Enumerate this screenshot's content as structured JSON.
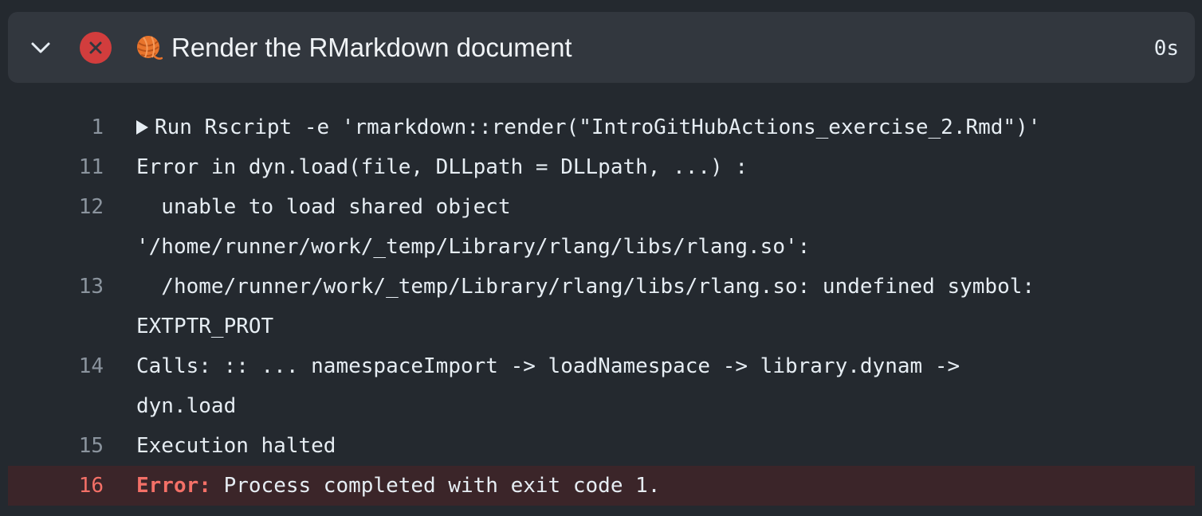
{
  "step": {
    "title": "Render the RMarkdown document",
    "duration": "0s",
    "status": "failure",
    "status_color": "#d23d3d",
    "emoji": "yarn-ball-emoji"
  },
  "log": {
    "line1": {
      "num": "1",
      "text": "Run Rscript -e 'rmarkdown::render(\"IntroGitHubActions_exercise_2.Rmd\")'"
    },
    "line11": {
      "num": "11",
      "text": "Error in dyn.load(file, DLLpath = DLLpath, ...) :"
    },
    "line12": {
      "num": "12",
      "text": "  unable to load shared object",
      "cont": "'/home/runner/work/_temp/Library/rlang/libs/rlang.so':"
    },
    "line13": {
      "num": "13",
      "text": "  /home/runner/work/_temp/Library/rlang/libs/rlang.so: undefined symbol:",
      "cont": "EXTPTR_PROT"
    },
    "line14": {
      "num": "14",
      "text": "Calls: :: ... namespaceImport -> loadNamespace -> library.dynam ->",
      "cont": "dyn.load"
    },
    "line15": {
      "num": "15",
      "text": "Execution halted"
    },
    "line16": {
      "num": "16",
      "label": "Error:",
      "text": " Process completed with exit code 1."
    }
  }
}
